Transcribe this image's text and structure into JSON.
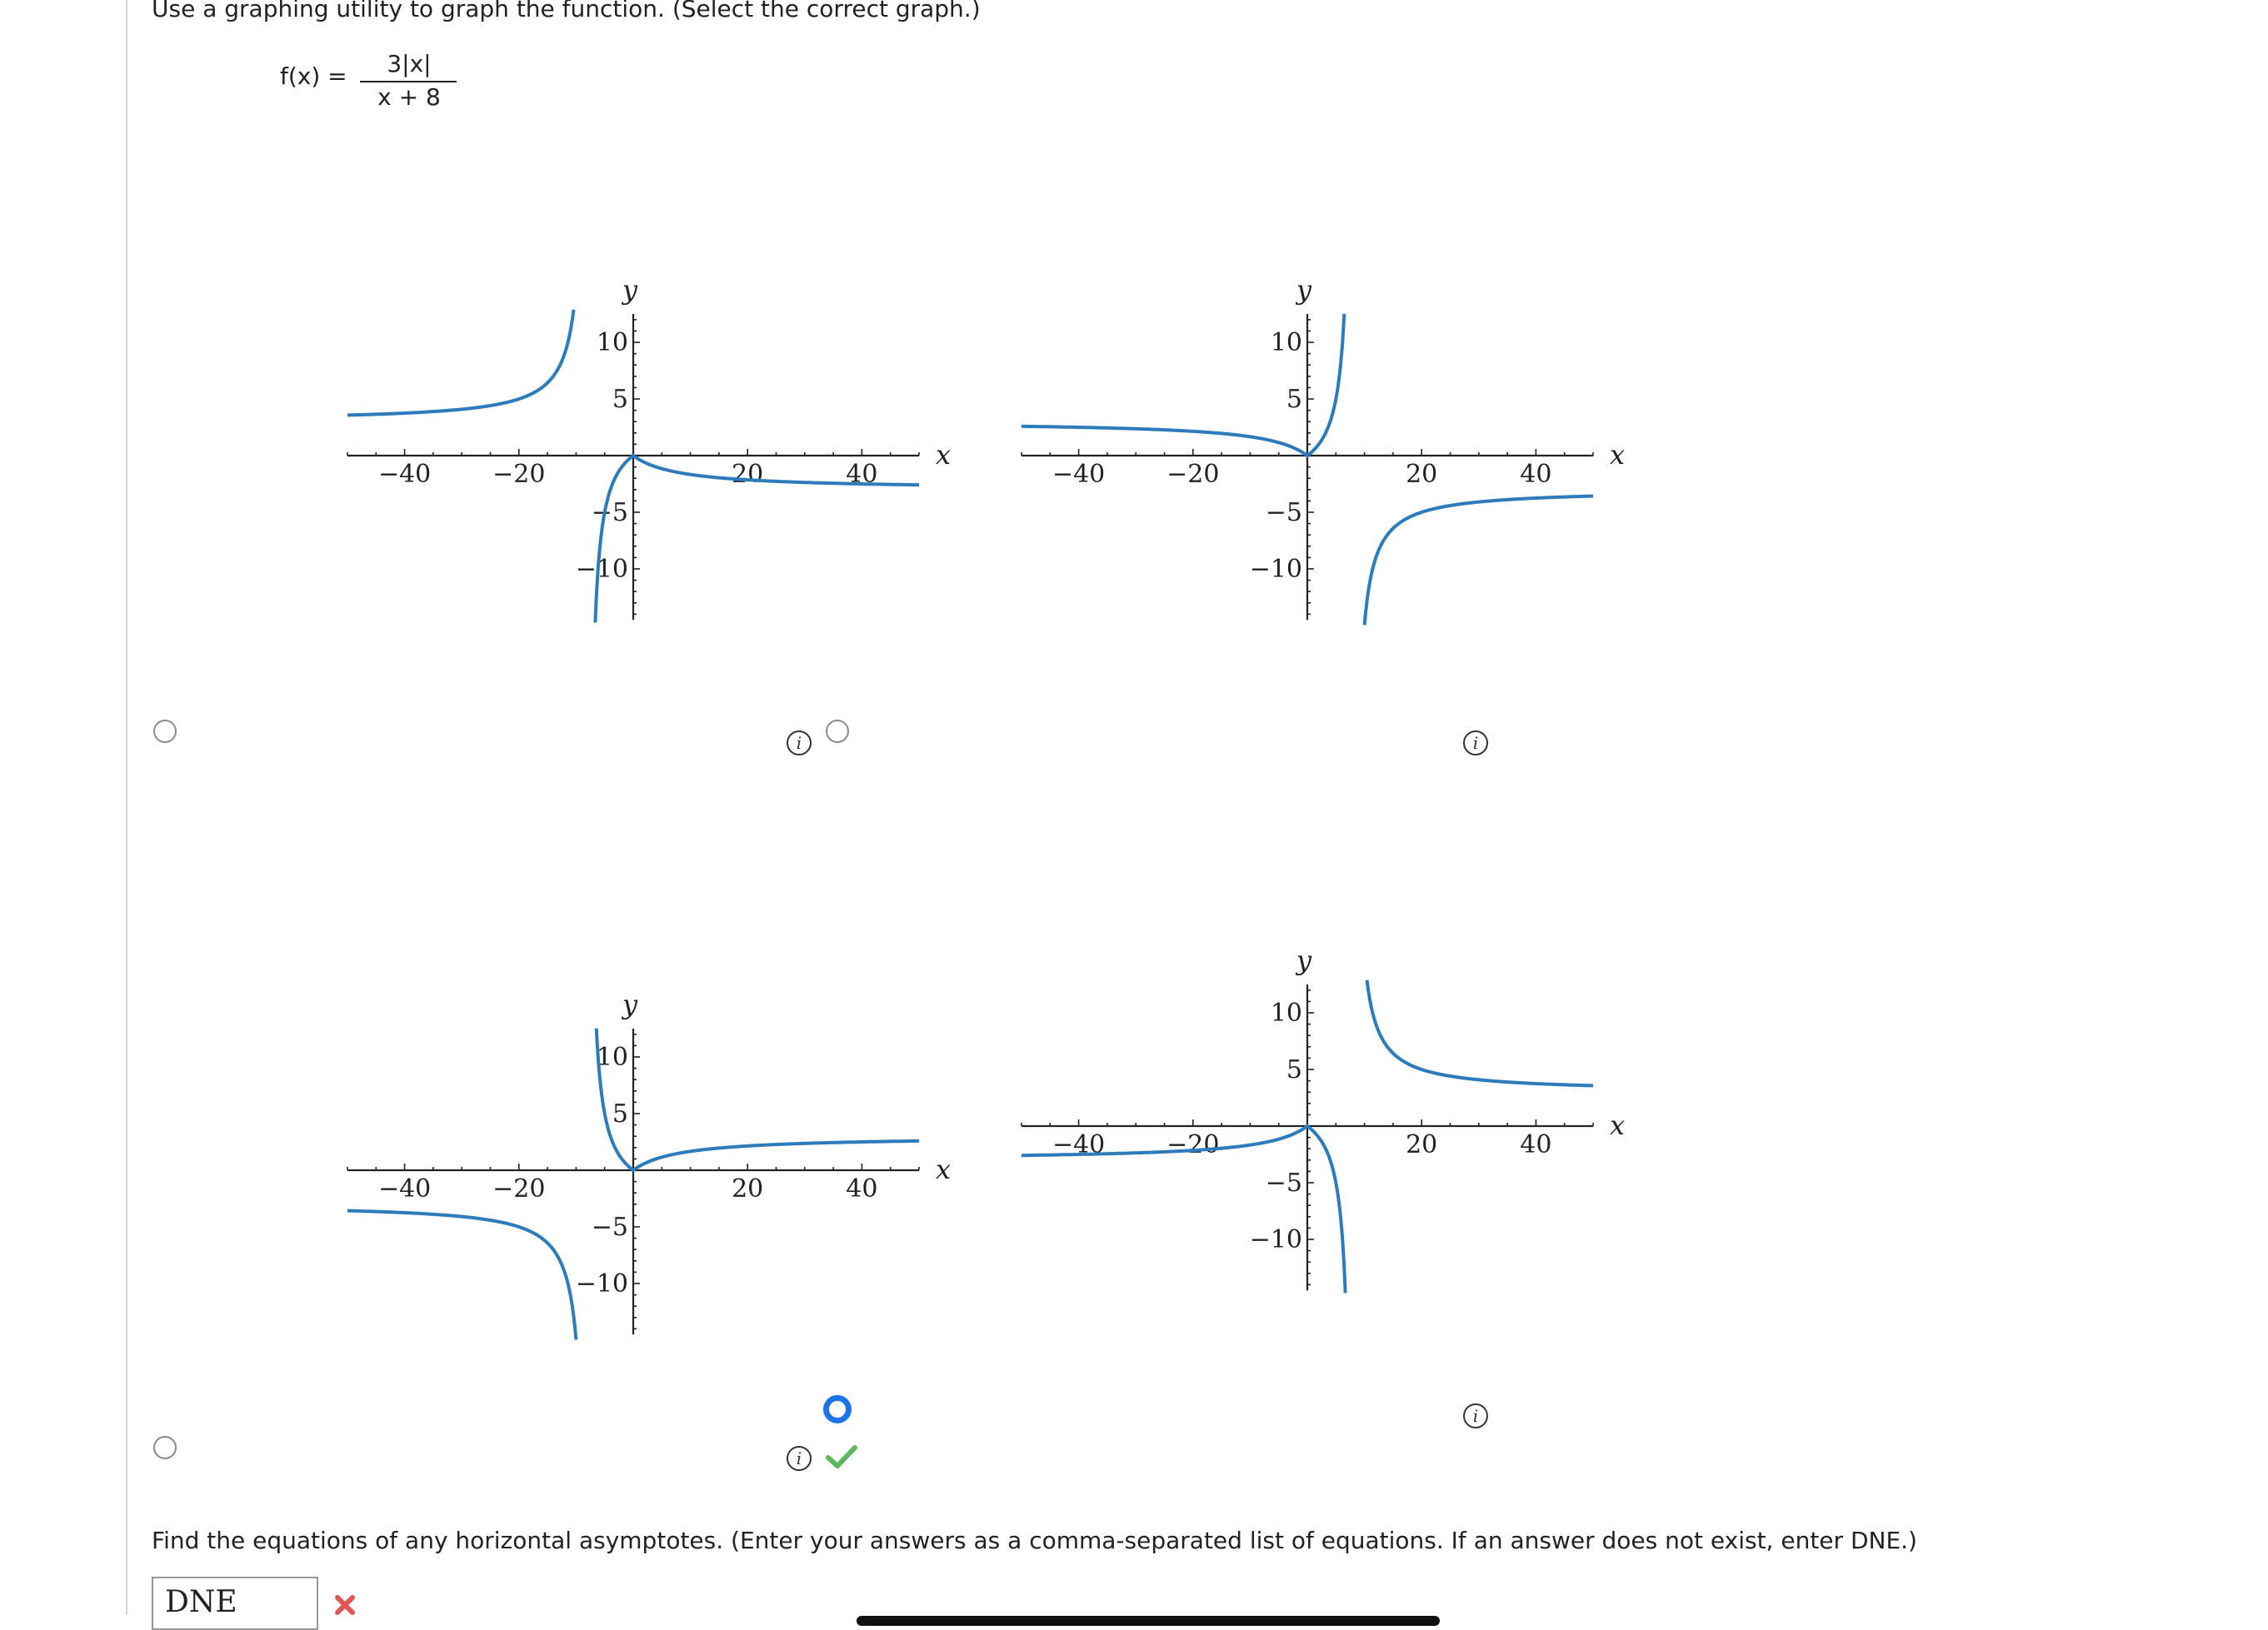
{
  "instruction": "Use a graphing utility to graph the function. (Select the correct graph.)",
  "function": {
    "lhs": "f(x) =",
    "numerator": "3|x|",
    "denominator": "x + 8"
  },
  "graphs": [
    {
      "id": "a",
      "selected": false,
      "correct": false
    },
    {
      "id": "b",
      "selected": false,
      "correct": false
    },
    {
      "id": "c",
      "selected": true,
      "correct": true
    },
    {
      "id": "d",
      "selected": false,
      "correct": false
    }
  ],
  "axis_labels": {
    "x": "x",
    "y": "y"
  },
  "x_tick_labels": [
    "−40",
    "−20",
    "20",
    "40"
  ],
  "y_tick_labels": [
    "10",
    "5",
    "−5",
    "−10"
  ],
  "info_icon": "i",
  "question2": "Find the equations of any horizontal asymptotes. (Enter your answers as a comma-separated list of equations. If an answer does not exist, enter DNE.)",
  "answer_value": "DNE",
  "answer_status": "incorrect",
  "colors": {
    "curve": "#2b7bbd",
    "radio_selected": "#1a73e8",
    "check": "#5cb85c",
    "x_mark": "#e05555"
  },
  "icons": [
    "info-icon",
    "check-icon",
    "x-mark-icon"
  ]
}
